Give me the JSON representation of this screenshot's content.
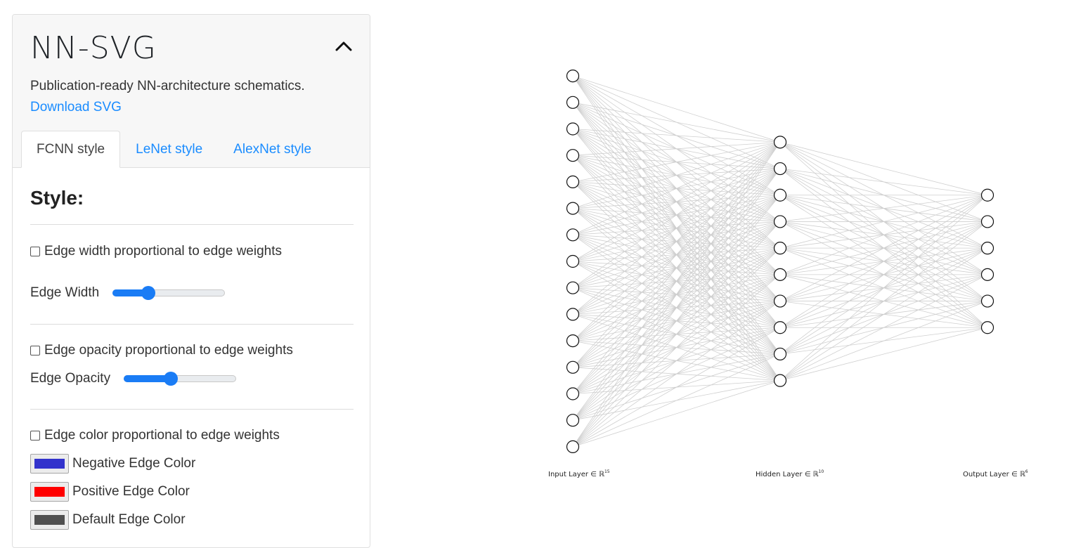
{
  "app": {
    "title": "NN-SVG",
    "tagline": "Publication-ready NN-architecture schematics.",
    "download_label": "Download SVG"
  },
  "tabs": [
    {
      "label": "FCNN style",
      "active": true
    },
    {
      "label": "LeNet style",
      "active": false
    },
    {
      "label": "AlexNet style",
      "active": false
    }
  ],
  "style": {
    "heading": "Style:",
    "edge_width": {
      "checkbox_label": "Edge width proportional to edge weights",
      "checked": false,
      "slider_label": "Edge Width",
      "value_fraction": 0.32
    },
    "edge_opacity": {
      "checkbox_label": "Edge opacity proportional to edge weights",
      "checked": false,
      "slider_label": "Edge Opacity",
      "value_fraction": 0.42
    },
    "edge_color": {
      "checkbox_label": "Edge color proportional to edge weights",
      "checked": false,
      "colors": [
        {
          "label": "Negative Edge Color",
          "value": "#3333cc"
        },
        {
          "label": "Positive Edge Color",
          "value": "#ff0000"
        },
        {
          "label": "Default Edge Color",
          "value": "#505050"
        }
      ]
    }
  },
  "network": {
    "architecture": [
      15,
      10,
      6
    ],
    "edge_color": "#cfcfcf",
    "layers": [
      {
        "label": "Input Layer ∈ ℝ",
        "dim": "15"
      },
      {
        "label": "Hidden Layer ∈ ℝ",
        "dim": "10"
      },
      {
        "label": "Output Layer ∈ ℝ",
        "dim": "6"
      }
    ]
  }
}
